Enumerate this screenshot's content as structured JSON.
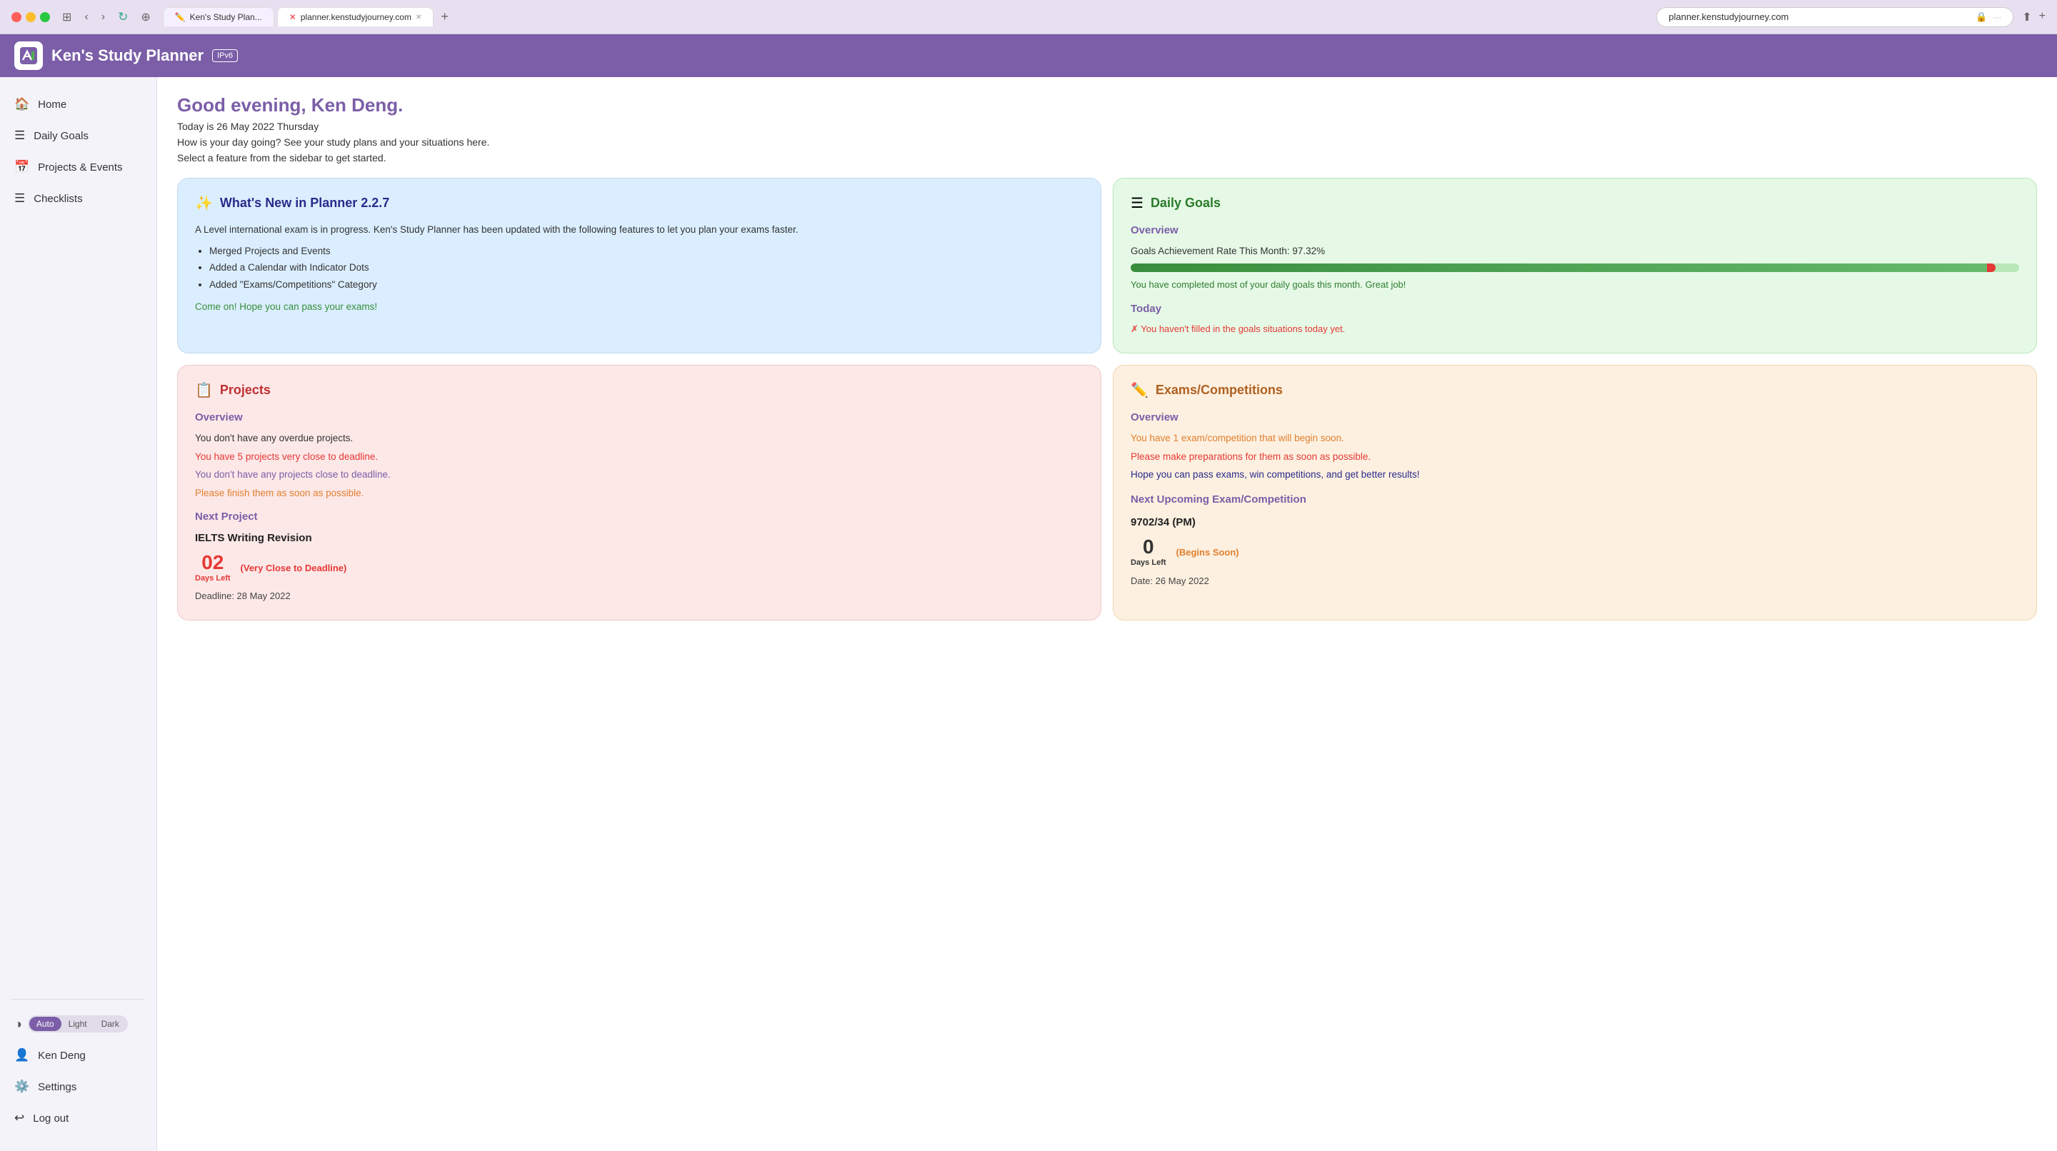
{
  "browser": {
    "tab1_label": "Ken's Study Plan...",
    "tab2_label": "planner.kenstudyjourney.com",
    "url": "planner.kenstudyjourney.com",
    "ipv6_label": "IPv6"
  },
  "app": {
    "logo_text": "✏️",
    "title": "Ken's Study Planner",
    "ipv6_badge": "IPv6"
  },
  "sidebar": {
    "items": [
      {
        "icon": "🏠",
        "label": "Home"
      },
      {
        "icon": "☰",
        "label": "Daily Goals"
      },
      {
        "icon": "📅",
        "label": "Projects & Events"
      },
      {
        "icon": "☰",
        "label": "Checklists"
      }
    ],
    "theme_label": "Theme",
    "theme_options": [
      "Auto",
      "Light",
      "Dark"
    ],
    "theme_active": "Auto",
    "user_icon": "👤",
    "user_name": "Ken Deng",
    "settings_icon": "⚙️",
    "settings_label": "Settings",
    "logout_icon": "🚪",
    "logout_label": "Log out"
  },
  "main": {
    "greeting": "Good evening, Ken Deng.",
    "date_line": "Today is 26 May 2022 Thursday",
    "how_line": "How is your day going? See your study plans and your situations here.",
    "select_line": "Select a feature from the sidebar to get started.",
    "whats_new": {
      "icon": "✨",
      "title": "What's New in Planner 2.2.7",
      "body": "A Level international exam is in progress. Ken's Study Planner has been updated with the following features to let you plan your exams faster.",
      "bullets": [
        "Merged Projects and Events",
        "Added a Calendar with Indicator Dots",
        "Added \"Exams/Competitions\" Category"
      ],
      "encourage": "Come on! Hope you can pass your exams!"
    },
    "daily_goals": {
      "icon": "☰",
      "title": "Daily Goals",
      "overview_label": "Overview",
      "rate_text": "Goals Achievement Rate This Month: 97.32%",
      "progress_percent": 97.32,
      "encourage_text": "You have completed most of your daily goals this month. Great job!",
      "today_label": "Today",
      "today_status": "✗ You haven't filled in the goals situations today yet."
    },
    "projects": {
      "icon": "📋",
      "title": "Projects",
      "overview_label": "Overview",
      "no_overdue": "You don't have any overdue projects.",
      "very_close": "You have 5 projects very close to deadline.",
      "none_close": "You don't have any projects close to deadline.",
      "finish_soon": "Please finish them as soon as possible.",
      "next_label": "Next Project",
      "project_name": "IELTS Writing Revision",
      "days_number": "02",
      "days_left_label": "Days Left",
      "very_close_badge": "(Very Close to Deadline)",
      "deadline_text": "Deadline: 28 May 2022"
    },
    "exams": {
      "icon": "✏️",
      "title": "Exams/Competitions",
      "overview_label": "Overview",
      "warning": "You have 1 exam/competition that will begin soon.",
      "danger": "Please make preparations for them as soon as possible.",
      "hope": "Hope you can pass exams, win competitions, and get better results!",
      "next_label": "Next Upcoming Exam/Competition",
      "exam_name": "9702/34 (PM)",
      "days_number": "0",
      "days_left_label": "Days Left",
      "begins_soon_badge": "(Begins Soon)",
      "date_text": "Date: 26 May 2022"
    }
  }
}
